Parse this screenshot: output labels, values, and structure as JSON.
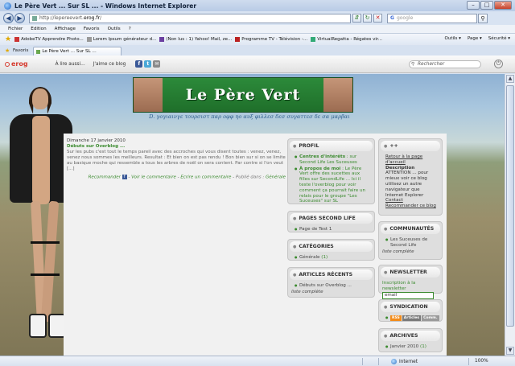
{
  "window": {
    "title": "Le Père Vert ... Sur SL ... - Windows Internet Explorer",
    "buttons": {
      "minimize": "–",
      "maximize": "□",
      "close": "✕"
    }
  },
  "address": {
    "url_prefix": "http://lepereevert.",
    "url_domain": "erog.fr",
    "url_suffix": "/",
    "search_brand": "G",
    "search_placeholder": "google"
  },
  "menu": [
    "Fichier",
    "Edition",
    "Affichage",
    "Favoris",
    "Outils",
    "?"
  ],
  "favorites_bar": {
    "items": [
      "AdobeTV  Apprendre Photo...",
      "Lorem Ipsum  générateur d...",
      "(Non lus : 1) Yahoo! Mail, ze...",
      "Programme TV - Télévision -...",
      "VirtualRegatta - Régates vir..."
    ],
    "right": [
      "Outils ▾",
      "Page ▾",
      "Sécurité ▾"
    ]
  },
  "tabs": {
    "favoris": "Favoris",
    "active": "Le Père Vert ... Sur SL ..."
  },
  "erog_toolbar": {
    "logo": "erog",
    "link_read": "À lire aussi...",
    "link_like": "J'aime ce blog",
    "social": [
      "f",
      "t",
      "✉"
    ],
    "search_placeholder": "Rechercher"
  },
  "site": {
    "title": "Le Père Vert",
    "tagline": "D. γογιαινγε τουρσιστ παρ οφφ ηο αυξ φιλλεσ δεσ συγαττεσ δε σα μαρβαι"
  },
  "post": {
    "date": "Dimanche 17 janvier 2010",
    "title": "Débuts sur Overblog ...",
    "body": "Sur les pubs c'est tout le temps pareil avec des accroches qui vous disent toutes : venez, venez, venez nous sommes les meilleurs. Resultat : Et bien on est pas rendu ! Bon bien sur si on se limite au basique moche qui ressemble a tous les arbres de noël on sera content. Par contre si l'on veut [...]",
    "recommend": "Recommander",
    "read_comment": "Voir le commentaire",
    "write_comment": "Ecrire un commentaire",
    "published_in_label": "Publié dans :",
    "category": "Générale"
  },
  "widgets": {
    "profil": {
      "title": "PROFIL",
      "items": [
        {
          "link": "Centres d'intérêts",
          "text": " : sur Second Life Les Suceuses"
        },
        {
          "link": "À propos de moi",
          "text": " : Le Père Vert offre des sucettes aux filles sur SecondLife ... Ici il teste l'overblog pour voir comment ça pourrait faire un relais pour le groupe \"Les Suceuses\" sur SL"
        }
      ]
    },
    "pages": {
      "title": "PAGES SECOND LIFE",
      "items": [
        "Page de Test 1"
      ]
    },
    "categories": {
      "title": "CATÉGORIES",
      "item": "Générale",
      "count": "(1)"
    },
    "articles": {
      "title": "ARTICLES RÉCENTS",
      "item": "Débuts sur Overblog ...",
      "full_list": "liste complète"
    },
    "extra": {
      "title": "++",
      "home_link": "Retour à la page d'accueil",
      "description_title": "Description",
      "description": "ATTENTION ... pour mieux voir ce blog utilisez un autre navigateur que Internet Explorer",
      "contact": "Contact",
      "recommend": "Recommander ce blog"
    },
    "communautes": {
      "title": "COMMUNAUTÉS",
      "item": "Les Suceuses de Second Life",
      "full_list": "liste complète"
    },
    "newsletter": {
      "title": "NEWSLETTER",
      "label": "Inscription à la newsletter",
      "email_value": "email"
    },
    "syndication": {
      "title": "SYNDICATION",
      "badges": [
        "RSS",
        "Articles",
        "Comm."
      ]
    },
    "archives": {
      "title": "ARCHIVES",
      "item": "Janvier 2010",
      "count": "(1)"
    }
  },
  "status": {
    "zone": "Internet",
    "zoom": "100%"
  },
  "colors": {
    "accent_green": "#3a8a2e",
    "banner_green": "#2c8a3a",
    "erog_red": "#d63a2e"
  }
}
